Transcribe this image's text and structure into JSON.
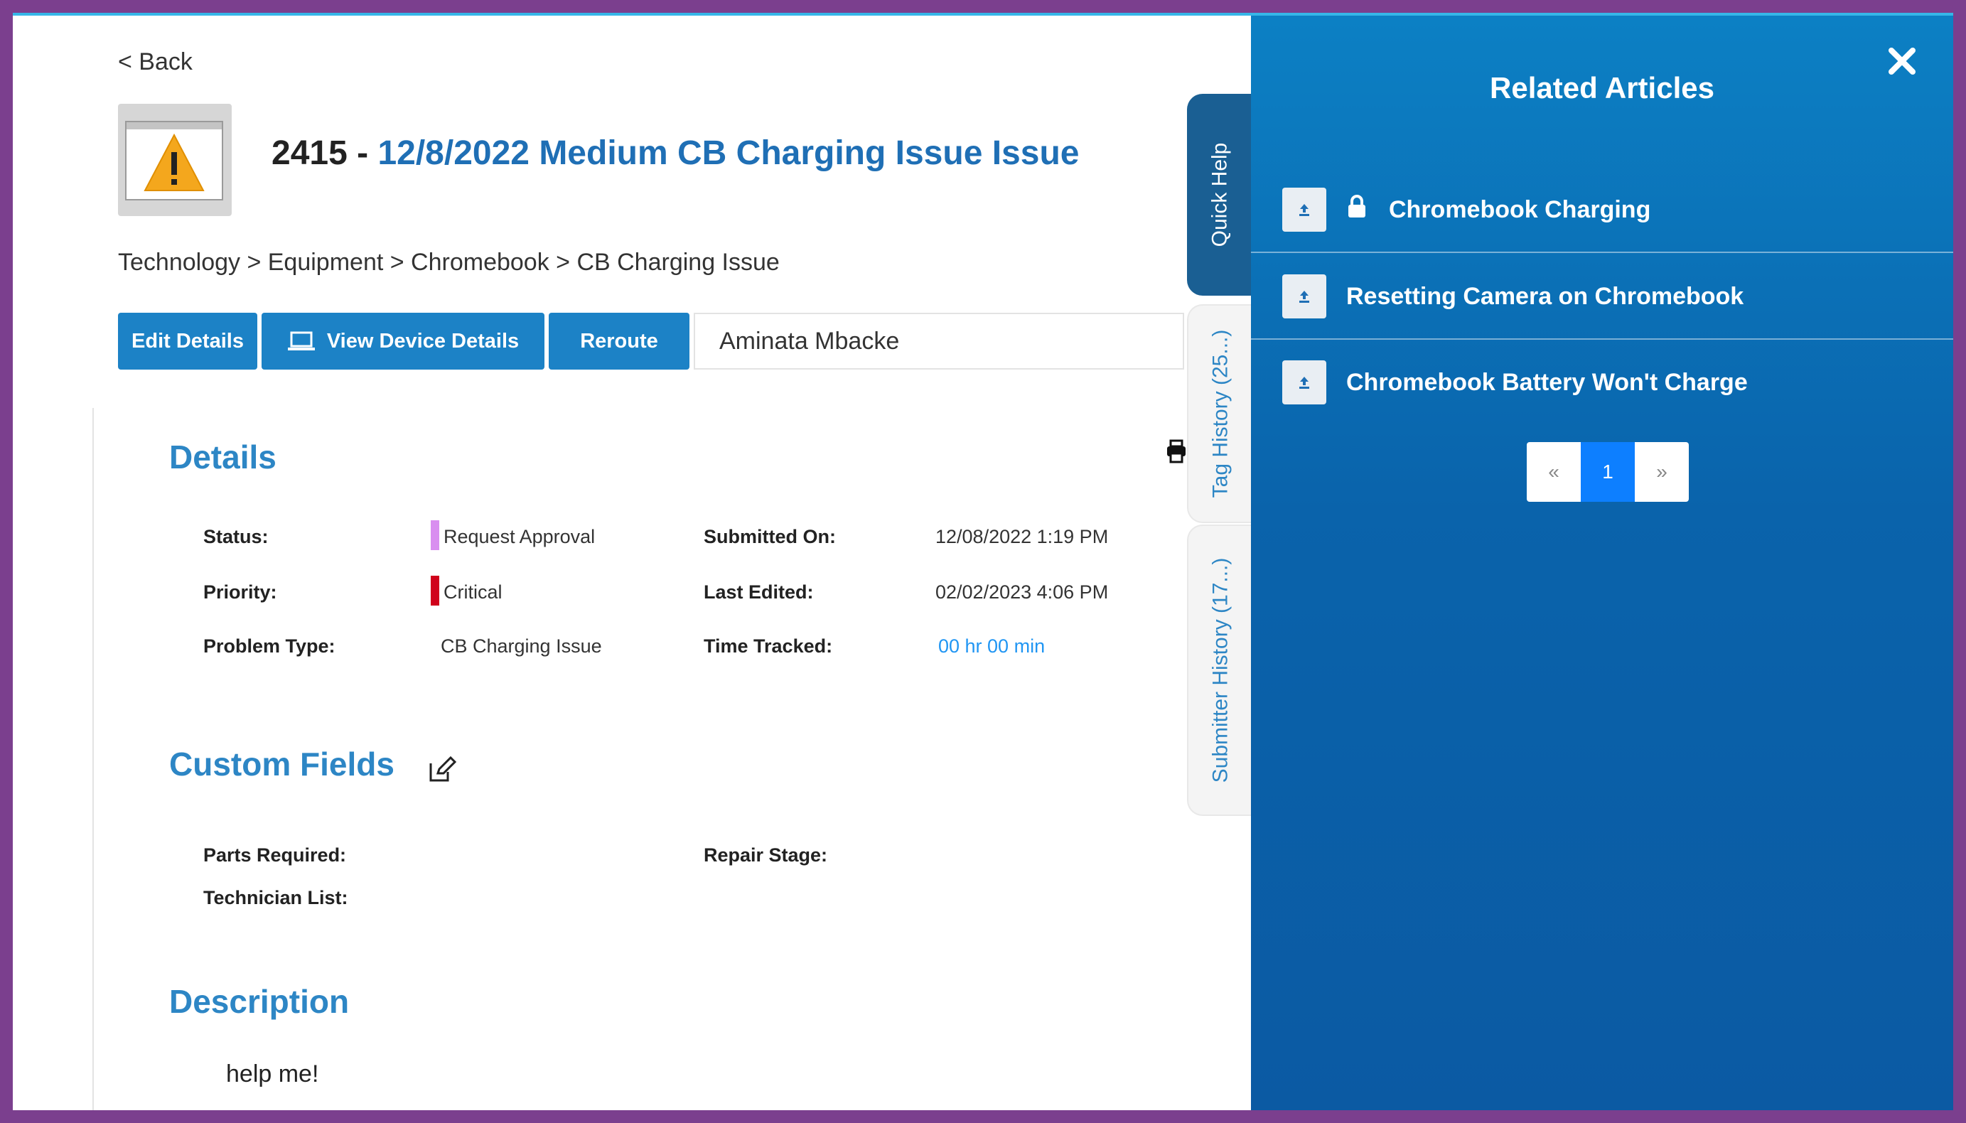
{
  "header": {
    "back_label": "< Back",
    "ticket_number": "2415 - ",
    "ticket_title": "12/8/2022 Medium CB Charging Issue Issue",
    "breadcrumb": "Technology > Equipment > Chromebook > CB Charging Issue"
  },
  "actions": {
    "edit_details": "Edit Details",
    "view_device_details": "View Device Details",
    "reroute": "Reroute",
    "assignee": "Aminata Mbacke"
  },
  "details": {
    "section_title": "Details",
    "status_label": "Status:",
    "status_value": "Request Approval",
    "status_color": "#d98ef0",
    "priority_label": "Priority:",
    "priority_value": "Critical",
    "priority_color": "#d0021b",
    "problem_type_label": "Problem Type:",
    "problem_type_value": "CB Charging Issue",
    "submitted_label": "Submitted On:",
    "submitted_value": "12/08/2022 1:19 PM",
    "edited_label": "Last Edited:",
    "edited_value": "02/02/2023 4:06 PM",
    "time_label": "Time Tracked:",
    "time_value": "00 hr 00 min"
  },
  "custom_fields": {
    "section_title": "Custom Fields",
    "parts_label": "Parts Required:",
    "repair_label": "Repair Stage:",
    "technician_label": "Technician List:"
  },
  "description": {
    "section_title": "Description",
    "text": "help me!"
  },
  "tabs": [
    {
      "label": "Quick Help",
      "active": true
    },
    {
      "label": "Tag History (25...)",
      "active": false
    },
    {
      "label": "Submitter History (17...)",
      "active": false
    }
  ],
  "panel": {
    "title": "Related Articles",
    "articles": [
      {
        "label": "Chromebook Charging",
        "locked": true
      },
      {
        "label": "Resetting Camera on Chromebook",
        "locked": false
      },
      {
        "label": "Chromebook Battery Won't Charge",
        "locked": false
      }
    ],
    "pager": {
      "prev": "«",
      "current": "1",
      "next": "»"
    }
  },
  "icons": [
    "warning-icon",
    "laptop-icon",
    "print-icon",
    "edit-icon",
    "close-icon",
    "upload-icon",
    "lock-icon"
  ]
}
